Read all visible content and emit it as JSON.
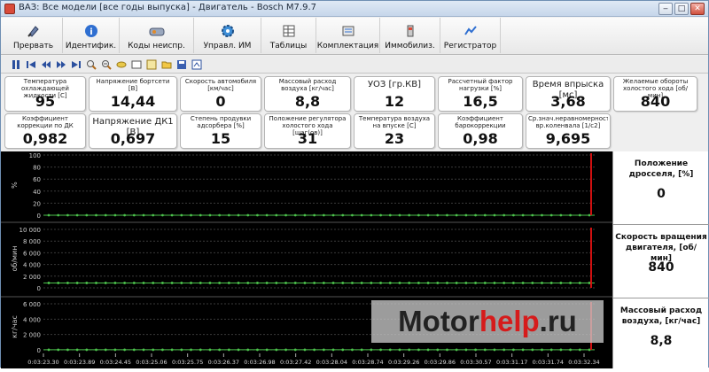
{
  "window": {
    "title": "ВАЗ: Все модели [все годы выпуска] - Двигатель - Bosch M7.9.7",
    "min_label": "‒",
    "max_label": "□",
    "close_label": "✕"
  },
  "toolbar": {
    "buttons": [
      {
        "label": "Прервать",
        "icon": "interrupt-icon"
      },
      {
        "label": "Идентифик.",
        "icon": "info-icon"
      },
      {
        "label": "Коды неиспр.",
        "icon": "fault-codes-icon"
      },
      {
        "label": "Управл. ИМ",
        "icon": "gear-icon"
      },
      {
        "label": "Таблицы",
        "icon": "table-icon"
      },
      {
        "label": "Комплектация",
        "icon": "configuration-icon"
      },
      {
        "label": "Иммобилиз.",
        "icon": "immobilizer-icon"
      },
      {
        "label": "Регистратор",
        "icon": "recorder-icon"
      }
    ]
  },
  "toolbar2": {
    "icons": [
      "pause-icon",
      "skip-first-icon",
      "prev-icon",
      "next-icon",
      "skip-last-icon",
      "zoom-in-icon",
      "zoom-out-icon",
      "link-icon",
      "fit-icon",
      "graph-icon",
      "open-icon",
      "save-icon",
      "export-icon"
    ]
  },
  "gauges": {
    "row1": [
      {
        "label": "Температура охлаждающей жидкости [C]",
        "value": "95",
        "big": false
      },
      {
        "label": "Напряжение бортсети [В]",
        "value": "14,44",
        "big": false
      },
      {
        "label": "Скорость автомобиля [км/час]",
        "value": "0",
        "big": false
      },
      {
        "label": "Массовый расход воздуха [кг/час]",
        "value": "8,8",
        "big": false
      },
      {
        "label": "УОЗ [гр.КВ]",
        "value": "12",
        "big": true
      },
      {
        "label": "Рассчетный фактор нагрузки [%]",
        "value": "16,5",
        "big": false
      },
      {
        "label": "Время впрыска [мс]",
        "value": "3,68",
        "big": true
      },
      {
        "label": "Желаемые обороты холостого хода [об/мин]",
        "value": "840",
        "big": false
      }
    ],
    "row2": [
      {
        "label": "Коэффициент коррекции по ДК",
        "value": "0,982",
        "big": false
      },
      {
        "label": "Напряжение ДК1 [В]",
        "value": "0,697",
        "big": true
      },
      {
        "label": "Степень продувки адсорбера [%]",
        "value": "15",
        "big": false
      },
      {
        "label": "Положение регулятора холостого хода [шаг(ов)]",
        "value": "31",
        "big": false
      },
      {
        "label": "Температура воздуха на впуске [C]",
        "value": "23",
        "big": false
      },
      {
        "label": "Коэффициент барокоррекции",
        "value": "0,98",
        "big": false
      },
      {
        "label": "Ср.знач.неравномерности вр.коленвала [1/c2]",
        "value": "9,695",
        "big": false
      }
    ]
  },
  "chart_data": [
    {
      "type": "line",
      "ylabel": "%",
      "ylim": [
        0,
        100
      ],
      "yticks": [
        "100",
        "80",
        "60",
        "40",
        "20",
        "0"
      ],
      "series": [
        {
          "values": [
            0
          ]
        }
      ],
      "grid": true
    },
    {
      "type": "line",
      "ylabel": "об/мин",
      "ylim": [
        0,
        10000
      ],
      "yticks": [
        "10 000",
        "8 000",
        "6 000",
        "4 000",
        "2 000",
        "0"
      ],
      "series": [
        {
          "values": [
            840
          ]
        }
      ],
      "grid": true
    },
    {
      "type": "line",
      "ylabel": "кг/час",
      "ylim": [
        0,
        6000
      ],
      "yticks": [
        "6 000",
        "4 000",
        "2 000",
        "0"
      ],
      "series": [
        {
          "values": [
            8.8
          ]
        }
      ],
      "grid": true
    }
  ],
  "time_axis": [
    "0:03:23.30",
    "0:03:23.89",
    "0:03:24.45",
    "0:03:25.06",
    "0:03:25.75",
    "0:03:26.37",
    "0:03:26.98",
    "0:03:27.42",
    "0:03:28.04",
    "0:03:28.74",
    "0:03:29.26",
    "0:03:29.86",
    "0:03:30.57",
    "0:03:31.17",
    "0:03:31.74",
    "0:03:32.34"
  ],
  "side_panel": [
    {
      "title": "Положение дросселя, [%]",
      "value": "0"
    },
    {
      "title": "Скорость вращения двигателя, [об/мин]",
      "value": "840"
    },
    {
      "title": "Массовый расход воздуха, [кг/час]",
      "value": "8,8"
    }
  ],
  "watermark": {
    "part1": "Motor",
    "part2": "help",
    "part3": ".ru"
  },
  "colors": {
    "trace": "#4cc24c",
    "cursor": "#d01010",
    "grid": "#3a3a3a"
  }
}
